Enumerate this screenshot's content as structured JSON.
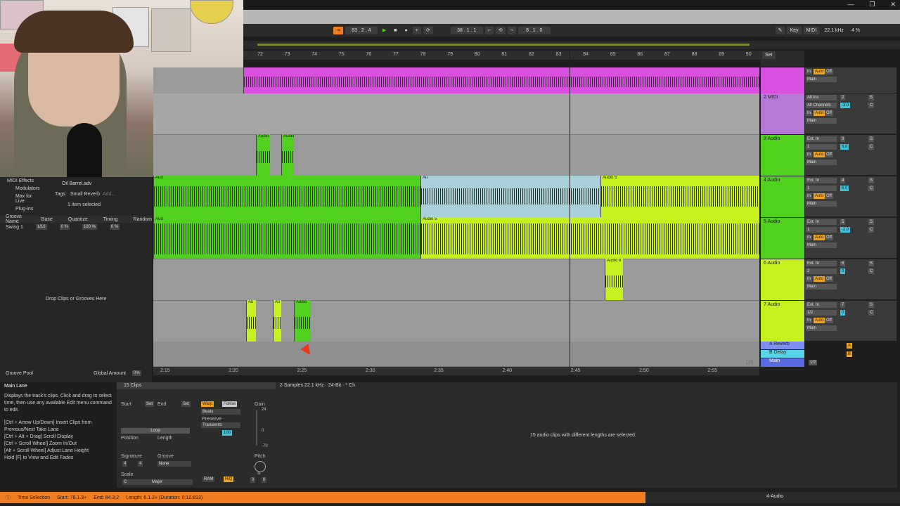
{
  "window": {
    "controls": [
      "—",
      "❐",
      "✕"
    ]
  },
  "transport": {
    "arrangement_pos": "83 . 2 . 4",
    "loop_start": "38 . 1 . 1",
    "loop_length": "8 . 1 . 0",
    "key_label": "Key",
    "midi_label": "MIDI",
    "sample_rate": "22.1 kHz",
    "cpu": "4 %"
  },
  "ruler": {
    "bars": [
      "72",
      "73",
      "74",
      "75",
      "76",
      "77",
      "78",
      "79",
      "80",
      "81",
      "82",
      "83",
      "84",
      "85",
      "86",
      "87",
      "88",
      "89",
      "90"
    ],
    "set_label": "Set"
  },
  "timeline": {
    "times": [
      "2:15",
      "2:20",
      "2:25",
      "2:30",
      "2:35",
      "2:40",
      "2:45",
      "2:50",
      "2:55"
    ],
    "zoom": "1/4"
  },
  "browser": {
    "items": [
      "MIDI Effects",
      "Modulators",
      "Max for Live",
      "Plug-ins"
    ],
    "file": "Oil Barrel.adv",
    "tags_label": "Tags:",
    "tag": "Small Reverb",
    "add": "Add...",
    "selection": "1 item selected",
    "groove_headers": [
      "Groove Name",
      "Base",
      "Quantize",
      "Timing",
      "Random"
    ],
    "groove_row": {
      "name": "Swing 1",
      "base": "1/16",
      "quantize": "0 %",
      "timing": "100 %",
      "random": "0 %"
    },
    "drop_hint": "Drop Clips or Grooves Here",
    "groove_pool": "Groove Pool",
    "global_amount_label": "Global Amount",
    "global_amount": "0%"
  },
  "tracks": [
    {
      "name": "",
      "color": "#d94fe0"
    },
    {
      "name": "2 MIDI",
      "color": "#b67ad6",
      "num": "2",
      "vol": "-3.0",
      "routing": "All Ins",
      "channel": "All Channels"
    },
    {
      "name": "3 Audio",
      "color": "#4fd11e",
      "num": "3",
      "vol": "6.0",
      "routing": "Ext. In",
      "channel": "1"
    },
    {
      "name": "4 Audio",
      "color": "#4fd11e",
      "num": "4",
      "vol": "6.0",
      "routing": "Ext. In",
      "channel": "1"
    },
    {
      "name": "5 Audio",
      "color": "#4fd11e",
      "num": "5",
      "vol": "-2.0",
      "routing": "Ext. In",
      "channel": "1"
    },
    {
      "name": "6 Audio",
      "color": "#c5f21f",
      "num": "6",
      "vol": "0",
      "routing": "Ext. In",
      "channel": "2"
    },
    {
      "name": "7 Audio",
      "color": "#c5f21f",
      "num": "7",
      "vol": "0",
      "routing": "Ext. In",
      "channel": "1/2"
    }
  ],
  "mixer_labels": {
    "in": "In",
    "auto": "Auto",
    "off": "Off",
    "main": "Main",
    "s": "S",
    "c": "C"
  },
  "returns": [
    {
      "name": "A Reverb",
      "letter": "A",
      "color": "#7f8ff0"
    },
    {
      "name": "B Delay",
      "letter": "B",
      "color": "#57d6e8"
    },
    {
      "name": "Main",
      "letter": "",
      "color": "#5a6ae0",
      "vol": "1/2"
    }
  ],
  "clip_labels": {
    "audio": "Audio",
    "audio5": "Audio 5",
    "audio8": "Audio 8",
    "aud": "Aud",
    "au": "Au"
  },
  "info": {
    "title": "Main Lane",
    "desc": "Displays the track's clips. Click and drag to select time, then use any available Edit menu command to edit.",
    "shortcuts": "[Ctrl + Arrow Up/Down] Insert Clips from Previous/Next Take Lane\n[Ctrl + Alt + Drag] Scroll Display\n[Ctrl + Scroll Wheel] Zoom In/Out\n[Alt + Scroll Wheel] Adjust Lane Height\nHold [F] to View and Edit Fades"
  },
  "clipview": {
    "title": "15 Clips",
    "start": "Start",
    "end": "End",
    "set": "Set",
    "warp": "Warp",
    "follow": "Follow",
    "beats": "Beats",
    "preserve": "Preserve",
    "transients": "Transients",
    "transient_val": "100",
    "loop": "Loop",
    "position": "Position",
    "length": "Length",
    "signature": "Signature",
    "sig_num": "4",
    "sig_den": "4",
    "groove": "Groove",
    "groove_val": "None",
    "scale": "Scale",
    "scale_root": "C",
    "scale_mode": "Major",
    "gain": "Gain",
    "gain_top": "24",
    "gain_zero": "0",
    "gain_bottom": "-70",
    "pitch": "Pitch",
    "pitch_unit": "st",
    "pitch_vals": [
      "0",
      "0"
    ],
    "ram": "RAM",
    "hiq": "HiQ",
    "sample_info": "2 Samples  22.1 kHz · 24-Bit · * Ch",
    "selected_msg": "15 audio clips with different lengths are selected."
  },
  "status": {
    "text": "Time Selection",
    "start": "Start: 78.1.3+",
    "end": "End: 84.3.2",
    "length": "Length: 6.1.2+ (Duration: 0:12:813)",
    "track": "4-Audio"
  }
}
